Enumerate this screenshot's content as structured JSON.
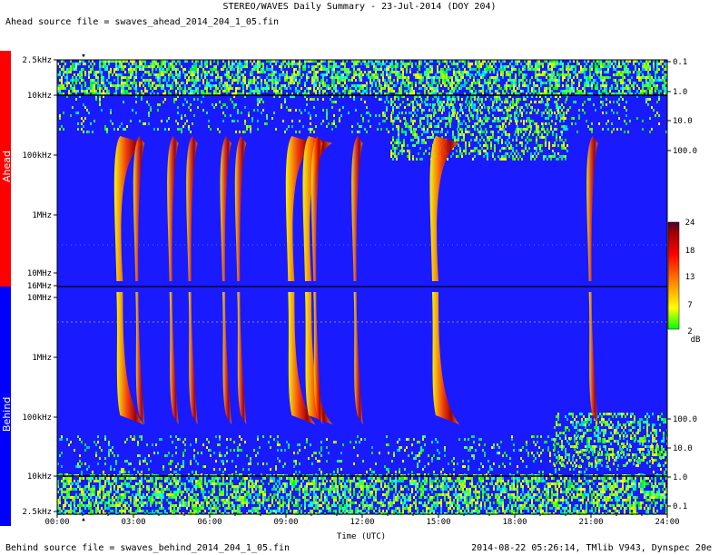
{
  "header": {
    "title": "STEREO/WAVES Daily Summary - 23-Jul-2014 (DOY 204)",
    "ahead_source": "Ahead source file = swaves_ahead_2014_204_1_05.fin",
    "behind_source": "Behind source file = swaves_behind_2014_204_1_05.fin",
    "stamp": "2014-08-22 05:26:14, TMlib V943, Dynspec 20e"
  },
  "sidebar": {
    "ahead_label": "Ahead",
    "behind_label": "Behind",
    "ahead_color": "#ff0000",
    "behind_color": "#0000ff"
  },
  "chart_data": {
    "type": "heatmap",
    "title": "STEREO/WAVES Daily Summary - 23-Jul-2014 (DOY 204)",
    "xlabel": "Time (UTC)",
    "x_ticks": [
      "00:00",
      "03:00",
      "06:00",
      "09:00",
      "12:00",
      "15:00",
      "18:00",
      "21:00",
      "24:00"
    ],
    "xlim": [
      "00:00",
      "24:00"
    ],
    "panels": [
      {
        "name": "Ahead",
        "y_scale": "log",
        "y_ticks": [
          "2.5kHz",
          "10kHz",
          "100kHz",
          "1MHz",
          "10MHz",
          "16MHz"
        ],
        "right_ticks": [
          "0.1",
          "1.0",
          "10.0",
          "100.0"
        ]
      },
      {
        "name": "Behind",
        "y_scale": "log",
        "y_ticks": [
          "16MHz",
          "10MHz",
          "1MHz",
          "100kHz",
          "10kHz",
          "2.5kHz"
        ],
        "right_ticks": [
          "100.0",
          "10.0",
          "1.0",
          "0.1"
        ]
      }
    ],
    "colorbar": {
      "unit": "dB",
      "ticks": [
        "24",
        "18",
        "13",
        "7",
        "2"
      ],
      "range": [
        2,
        24
      ]
    },
    "events": [
      {
        "time": "02:20",
        "type": "type III burst"
      },
      {
        "time": "03:05",
        "type": "type III burst"
      },
      {
        "time": "04:25",
        "type": "type III burst"
      },
      {
        "time": "05:10",
        "type": "type III burst"
      },
      {
        "time": "06:30",
        "type": "type III burst"
      },
      {
        "time": "07:05",
        "type": "type III burst"
      },
      {
        "time": "09:05",
        "type": "type III burst"
      },
      {
        "time": "09:45",
        "type": "type III burst"
      },
      {
        "time": "10:05",
        "type": "type III burst"
      },
      {
        "time": "11:40",
        "type": "type III burst"
      },
      {
        "time": "14:45",
        "type": "type III burst"
      },
      {
        "time": "20:55",
        "type": "type III burst"
      }
    ],
    "colors": {
      "background": "#1a1aff",
      "max": "#8b0000"
    }
  }
}
